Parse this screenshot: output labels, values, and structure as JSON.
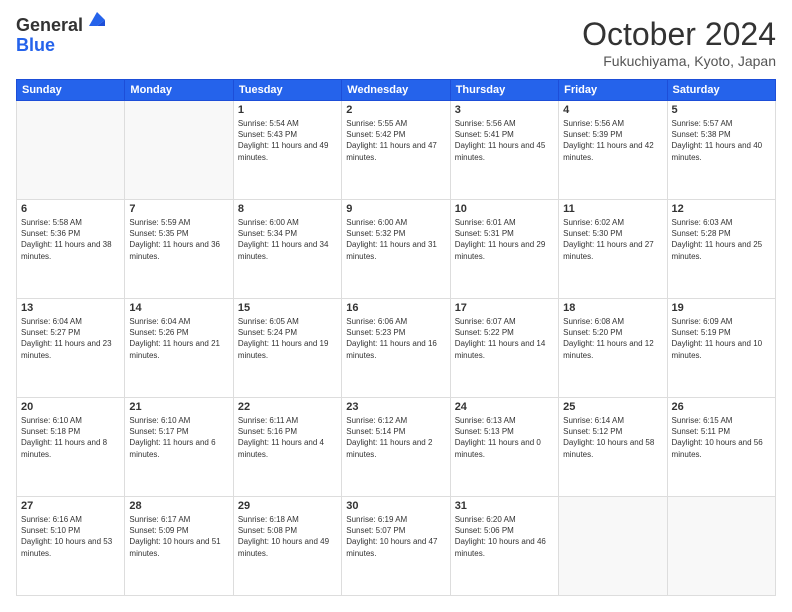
{
  "logo": {
    "general": "General",
    "blue": "Blue"
  },
  "header": {
    "month": "October 2024",
    "location": "Fukuchiyama, Kyoto, Japan"
  },
  "weekdays": [
    "Sunday",
    "Monday",
    "Tuesday",
    "Wednesday",
    "Thursday",
    "Friday",
    "Saturday"
  ],
  "weeks": [
    [
      {
        "day": "",
        "info": ""
      },
      {
        "day": "",
        "info": ""
      },
      {
        "day": "1",
        "info": "Sunrise: 5:54 AM\nSunset: 5:43 PM\nDaylight: 11 hours and 49 minutes."
      },
      {
        "day": "2",
        "info": "Sunrise: 5:55 AM\nSunset: 5:42 PM\nDaylight: 11 hours and 47 minutes."
      },
      {
        "day": "3",
        "info": "Sunrise: 5:56 AM\nSunset: 5:41 PM\nDaylight: 11 hours and 45 minutes."
      },
      {
        "day": "4",
        "info": "Sunrise: 5:56 AM\nSunset: 5:39 PM\nDaylight: 11 hours and 42 minutes."
      },
      {
        "day": "5",
        "info": "Sunrise: 5:57 AM\nSunset: 5:38 PM\nDaylight: 11 hours and 40 minutes."
      }
    ],
    [
      {
        "day": "6",
        "info": "Sunrise: 5:58 AM\nSunset: 5:36 PM\nDaylight: 11 hours and 38 minutes."
      },
      {
        "day": "7",
        "info": "Sunrise: 5:59 AM\nSunset: 5:35 PM\nDaylight: 11 hours and 36 minutes."
      },
      {
        "day": "8",
        "info": "Sunrise: 6:00 AM\nSunset: 5:34 PM\nDaylight: 11 hours and 34 minutes."
      },
      {
        "day": "9",
        "info": "Sunrise: 6:00 AM\nSunset: 5:32 PM\nDaylight: 11 hours and 31 minutes."
      },
      {
        "day": "10",
        "info": "Sunrise: 6:01 AM\nSunset: 5:31 PM\nDaylight: 11 hours and 29 minutes."
      },
      {
        "day": "11",
        "info": "Sunrise: 6:02 AM\nSunset: 5:30 PM\nDaylight: 11 hours and 27 minutes."
      },
      {
        "day": "12",
        "info": "Sunrise: 6:03 AM\nSunset: 5:28 PM\nDaylight: 11 hours and 25 minutes."
      }
    ],
    [
      {
        "day": "13",
        "info": "Sunrise: 6:04 AM\nSunset: 5:27 PM\nDaylight: 11 hours and 23 minutes."
      },
      {
        "day": "14",
        "info": "Sunrise: 6:04 AM\nSunset: 5:26 PM\nDaylight: 11 hours and 21 minutes."
      },
      {
        "day": "15",
        "info": "Sunrise: 6:05 AM\nSunset: 5:24 PM\nDaylight: 11 hours and 19 minutes."
      },
      {
        "day": "16",
        "info": "Sunrise: 6:06 AM\nSunset: 5:23 PM\nDaylight: 11 hours and 16 minutes."
      },
      {
        "day": "17",
        "info": "Sunrise: 6:07 AM\nSunset: 5:22 PM\nDaylight: 11 hours and 14 minutes."
      },
      {
        "day": "18",
        "info": "Sunrise: 6:08 AM\nSunset: 5:20 PM\nDaylight: 11 hours and 12 minutes."
      },
      {
        "day": "19",
        "info": "Sunrise: 6:09 AM\nSunset: 5:19 PM\nDaylight: 11 hours and 10 minutes."
      }
    ],
    [
      {
        "day": "20",
        "info": "Sunrise: 6:10 AM\nSunset: 5:18 PM\nDaylight: 11 hours and 8 minutes."
      },
      {
        "day": "21",
        "info": "Sunrise: 6:10 AM\nSunset: 5:17 PM\nDaylight: 11 hours and 6 minutes."
      },
      {
        "day": "22",
        "info": "Sunrise: 6:11 AM\nSunset: 5:16 PM\nDaylight: 11 hours and 4 minutes."
      },
      {
        "day": "23",
        "info": "Sunrise: 6:12 AM\nSunset: 5:14 PM\nDaylight: 11 hours and 2 minutes."
      },
      {
        "day": "24",
        "info": "Sunrise: 6:13 AM\nSunset: 5:13 PM\nDaylight: 11 hours and 0 minutes."
      },
      {
        "day": "25",
        "info": "Sunrise: 6:14 AM\nSunset: 5:12 PM\nDaylight: 10 hours and 58 minutes."
      },
      {
        "day": "26",
        "info": "Sunrise: 6:15 AM\nSunset: 5:11 PM\nDaylight: 10 hours and 56 minutes."
      }
    ],
    [
      {
        "day": "27",
        "info": "Sunrise: 6:16 AM\nSunset: 5:10 PM\nDaylight: 10 hours and 53 minutes."
      },
      {
        "day": "28",
        "info": "Sunrise: 6:17 AM\nSunset: 5:09 PM\nDaylight: 10 hours and 51 minutes."
      },
      {
        "day": "29",
        "info": "Sunrise: 6:18 AM\nSunset: 5:08 PM\nDaylight: 10 hours and 49 minutes."
      },
      {
        "day": "30",
        "info": "Sunrise: 6:19 AM\nSunset: 5:07 PM\nDaylight: 10 hours and 47 minutes."
      },
      {
        "day": "31",
        "info": "Sunrise: 6:20 AM\nSunset: 5:06 PM\nDaylight: 10 hours and 46 minutes."
      },
      {
        "day": "",
        "info": ""
      },
      {
        "day": "",
        "info": ""
      }
    ]
  ]
}
